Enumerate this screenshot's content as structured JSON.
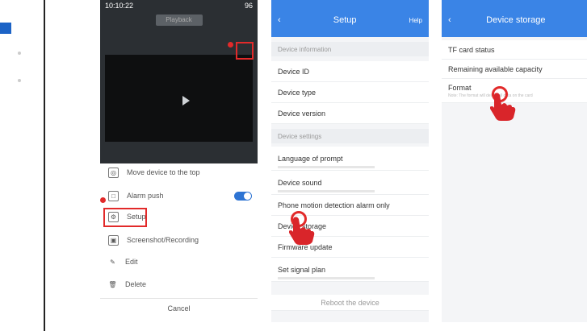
{
  "phone1": {
    "status_time": "10:10:22",
    "status_right": "96 ",
    "tab_active": "Playback",
    "menu": [
      {
        "icon": "pin-icon",
        "label": "Move device to the top"
      },
      {
        "icon": "bell-icon",
        "label": "Alarm push"
      },
      {
        "icon": "gear-icon",
        "label": "Setup"
      },
      {
        "icon": "folder-icon",
        "label": "Screenshot/Recording"
      },
      {
        "icon": "pencil-icon",
        "label": "Edit"
      },
      {
        "icon": "trash-icon",
        "label": "Delete"
      }
    ],
    "cancel": "Cancel"
  },
  "phone2": {
    "title": "Setup",
    "right": "Help",
    "group1": "Device information",
    "rows_a": [
      "Device ID",
      "Device type",
      "Device version"
    ],
    "group2": "Device settings",
    "rows_b": [
      "Language of prompt",
      "Device sound",
      "Phone motion detection alarm only",
      "Device storage",
      "Firmware update",
      "Set signal plan"
    ],
    "reboot": "Reboot the device"
  },
  "phone3": {
    "title": "Device storage",
    "rows": [
      "TF card status",
      "Remaining available capacity",
      "Format"
    ],
    "format_sub": "Note: The format will delete all data on the card"
  }
}
